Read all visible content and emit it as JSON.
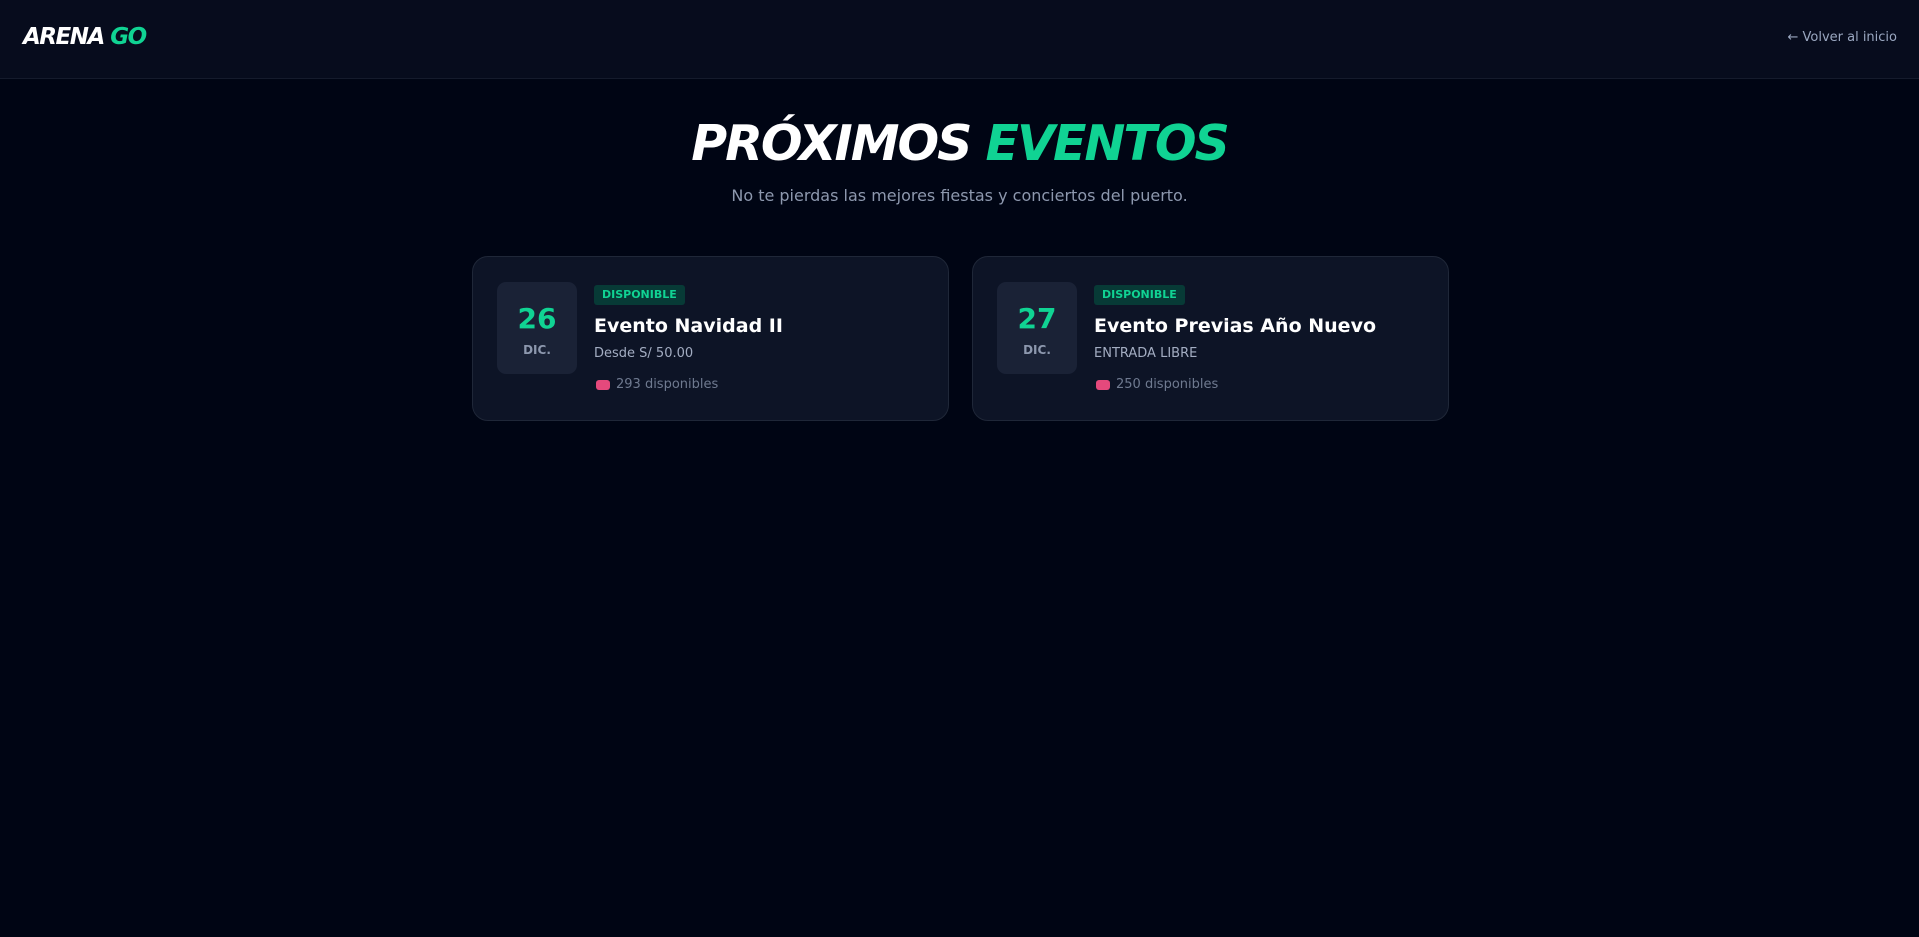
{
  "header": {
    "logo_primary": "ARENA",
    "logo_accent": "GO",
    "back_link": "← Volver al inicio"
  },
  "hero": {
    "title_primary": "PRÓXIMOS",
    "title_accent": "EVENTOS",
    "subtitle": "No te pierdas las mejores fiestas y conciertos del puerto."
  },
  "events": [
    {
      "day": "26",
      "month": "DIC.",
      "badge": "DISPONIBLE",
      "title": "Evento Navidad II",
      "price": "Desde S/ 50.00",
      "availability": "293 disponibles"
    },
    {
      "day": "27",
      "month": "DIC.",
      "badge": "DISPONIBLE",
      "title": "Evento Previas Año Nuevo",
      "price": "ENTRADA LIBRE",
      "availability": "250 disponibles"
    }
  ],
  "colors": {
    "background": "#000514",
    "accent": "#10d393",
    "ticket_icon": "#e5497c"
  },
  "icons": {
    "ticket": "ticket-icon"
  }
}
